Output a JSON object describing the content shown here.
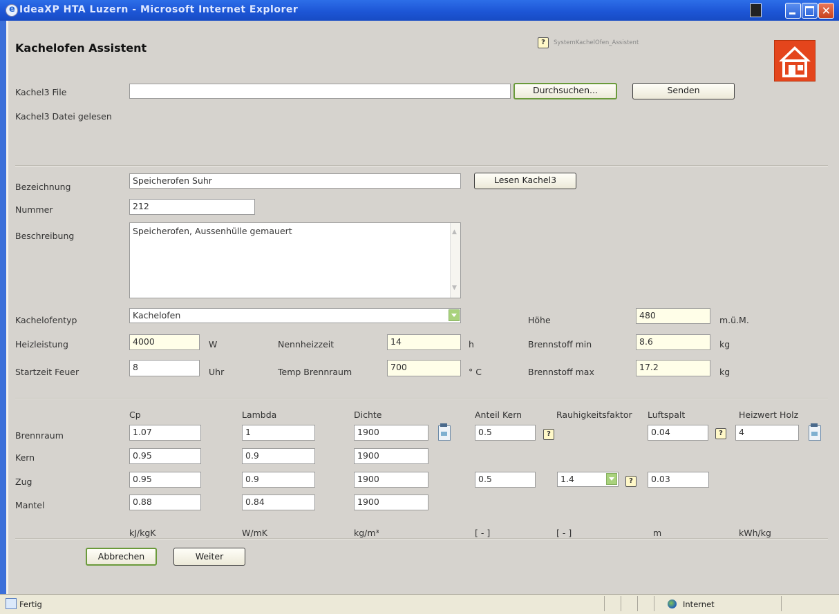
{
  "window": {
    "title": "IdeaXP HTA Luzern - Microsoft Internet Explorer",
    "status_text": "Fertig",
    "zone_text": "Internet"
  },
  "header": {
    "title": "Kachelofen Assistent",
    "help_link": "SystemKachelOfen_Assistent"
  },
  "upload": {
    "file_label": "Kachel3 File",
    "file_value": "",
    "browse_button": "Durchsuchen...",
    "send_button": "Senden",
    "status_text": "Kachel3 Datei gelesen"
  },
  "form": {
    "bezeichnung_label": "Bezeichnung",
    "bezeichnung_value": "Speicherofen Suhr",
    "read_button": "Lesen Kachel3",
    "nummer_label": "Nummer",
    "nummer_value": "212",
    "beschreibung_label": "Beschreibung",
    "beschreibung_value": "Speicherofen, Aussenhülle gemauert",
    "typ_label": "Kachelofentyp",
    "typ_value": "Kachelofen",
    "hoehe_label": "Höhe",
    "hoehe_value": "480",
    "hoehe_unit": "m.ü.M.",
    "heizleistung_label": "Heizleistung",
    "heizleistung_value": "4000",
    "heizleistung_unit": "W",
    "nennheizzeit_label": "Nennheizzeit",
    "nennheizzeit_value": "14",
    "nennheizzeit_unit": "h",
    "brennstoff_min_label": "Brennstoff min",
    "brennstoff_min_value": "8.6",
    "brennstoff_min_unit": "kg",
    "startzeit_label": "Startzeit Feuer",
    "startzeit_value": "8",
    "startzeit_unit": "Uhr",
    "temp_label": "Temp Brennraum",
    "temp_value": "700",
    "temp_unit": "° C",
    "brennstoff_max_label": "Brennstoff max",
    "brennstoff_max_value": "17.2",
    "brennstoff_max_unit": "kg"
  },
  "table": {
    "headers": {
      "cp": "Cp",
      "lambda": "Lambda",
      "dichte": "Dichte",
      "anteil_kern": "Anteil Kern",
      "rauhigkeit": "Rauhigkeitsfaktor",
      "luftspalt": "Luftspalt",
      "heizwert": "Heizwert Holz"
    },
    "rows": [
      {
        "label": "Brennraum",
        "cp": "1.07",
        "lambda": "1",
        "dichte": "1900",
        "anteil_kern": "0.5",
        "luftspalt": "0.04",
        "heizwert": "4"
      },
      {
        "label": "Kern",
        "cp": "0.95",
        "lambda": "0.9",
        "dichte": "1900"
      },
      {
        "label": "Zug",
        "cp": "0.95",
        "lambda": "0.9",
        "dichte": "1900",
        "anteil_kern": "0.5",
        "rauhigkeit": "1.4",
        "luftspalt": "0.03"
      },
      {
        "label": "Mantel",
        "cp": "0.88",
        "lambda": "0.84",
        "dichte": "1900"
      }
    ],
    "units": {
      "cp": "kJ/kgK",
      "lambda": "W/mK",
      "dichte": "kg/m³",
      "anteil_kern": "[ - ]",
      "rauhigkeit": "[ - ]",
      "luftspalt": "m",
      "heizwert": "kWh/kg"
    }
  },
  "actions": {
    "cancel_button": "Abbrechen",
    "next_button": "Weiter"
  }
}
